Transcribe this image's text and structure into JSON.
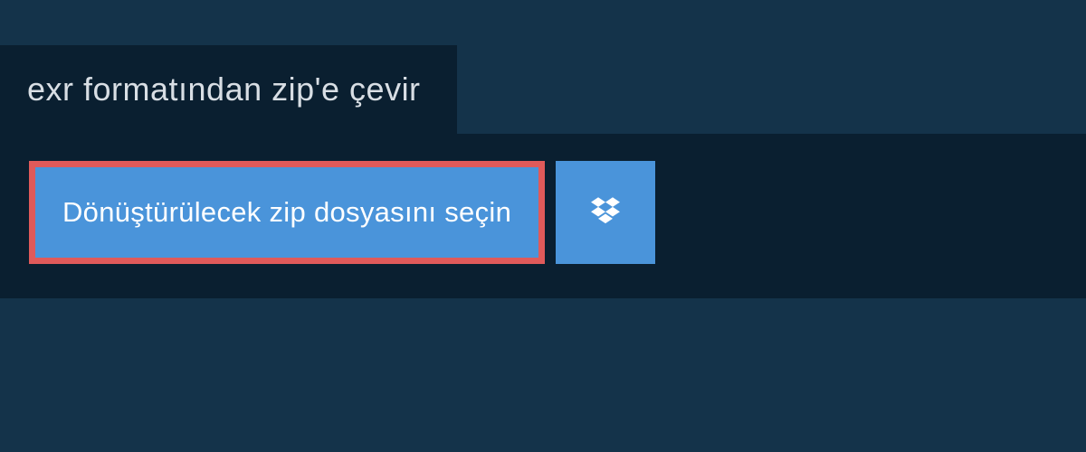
{
  "header": {
    "title": "exr formatından zip'e çevir"
  },
  "main": {
    "select_button_label": "Dönüştürülecek zip dosyasını seçin"
  },
  "colors": {
    "bg_outer": "#14334a",
    "bg_panel": "#0a1f30",
    "button_bg": "#4a94da",
    "highlight_border": "#e05a5a"
  }
}
